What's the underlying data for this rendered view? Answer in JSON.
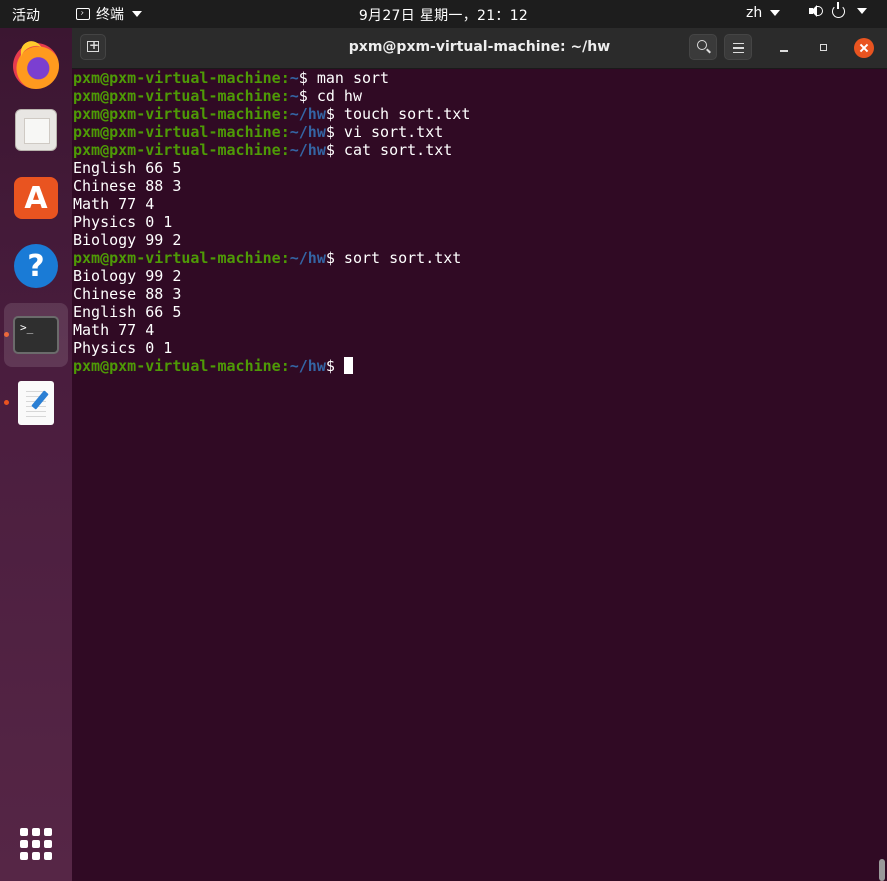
{
  "topbar": {
    "activities": "活动",
    "app_name": "终端",
    "clock": "9月27日 星期一，21：12",
    "language": "zh"
  },
  "dock": {
    "items": [
      {
        "name": "firefox",
        "icon": "firefox-icon",
        "running": false
      },
      {
        "name": "files",
        "icon": "files-icon",
        "running": false
      },
      {
        "name": "ubuntu-software",
        "icon": "software-store-icon",
        "running": false
      },
      {
        "name": "help",
        "icon": "help-icon",
        "running": false
      },
      {
        "name": "terminal",
        "icon": "terminal-icon",
        "running": true,
        "active": true
      },
      {
        "name": "text-editor",
        "icon": "text-editor-icon",
        "running": true
      }
    ],
    "terminal_glyph": ">_"
  },
  "window": {
    "title": "pxm@pxm-virtual-machine: ~/hw"
  },
  "terminal": {
    "user_host": "pxm@pxm-virtual-machine",
    "lines": [
      {
        "type": "prompt",
        "path": "~",
        "command": "man sort"
      },
      {
        "type": "prompt",
        "path": "~",
        "command": "cd hw"
      },
      {
        "type": "prompt",
        "path": "~/hw",
        "command": "touch sort.txt"
      },
      {
        "type": "prompt",
        "path": "~/hw",
        "command": "vi sort.txt"
      },
      {
        "type": "prompt",
        "path": "~/hw",
        "command": "cat sort.txt"
      },
      {
        "type": "output",
        "text": "English 66 5"
      },
      {
        "type": "output",
        "text": "Chinese 88 3"
      },
      {
        "type": "output",
        "text": "Math 77 4"
      },
      {
        "type": "output",
        "text": "Physics 0 1"
      },
      {
        "type": "output",
        "text": "Biology 99 2"
      },
      {
        "type": "prompt",
        "path": "~/hw",
        "command": "sort sort.txt"
      },
      {
        "type": "output",
        "text": "Biology 99 2"
      },
      {
        "type": "output",
        "text": "Chinese 88 3"
      },
      {
        "type": "output",
        "text": "English 66 5"
      },
      {
        "type": "output",
        "text": "Math 77 4"
      },
      {
        "type": "output",
        "text": "Physics 0 1"
      },
      {
        "type": "prompt",
        "path": "~/hw",
        "command": "",
        "cursor": true
      }
    ]
  },
  "colors": {
    "terminal_bg": "#300a24",
    "user_host": "#4e9a06",
    "path": "#3465a4",
    "accent": "#e95420"
  }
}
